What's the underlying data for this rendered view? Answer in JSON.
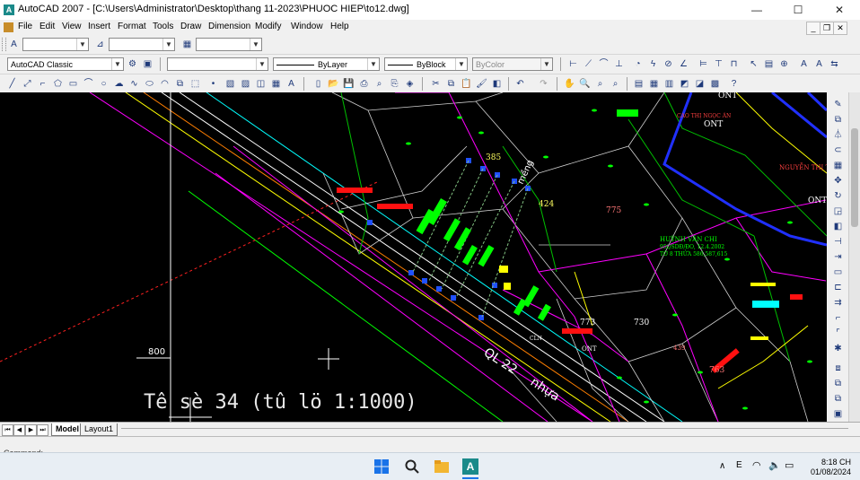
{
  "window": {
    "title": "AutoCAD 2007 - [C:\\Users\\Administrator\\Desktop\\thang 11-2023\\PHUOC HIEP\\to12.dwg]",
    "controls": {
      "minimize": "—",
      "maximize": "☐",
      "close": "✕"
    },
    "mdi_controls": {
      "minimize": "_",
      "restore": "❐",
      "close": "✕"
    }
  },
  "menu": [
    "File",
    "Edit",
    "View",
    "Insert",
    "Format",
    "Tools",
    "Draw",
    "Dimension",
    "Modify",
    "Window",
    "Help"
  ],
  "workspace": {
    "selected": "AutoCAD Classic"
  },
  "properties": {
    "linetype": "ByLayer",
    "lineweight": "ByBlock",
    "color": "ByColor"
  },
  "drawing": {
    "big_label": "Tê sè 34 (tû lö 1:1000)",
    "number_800": "800",
    "road_label": "QL 22",
    "road_label2": "nhựa",
    "parcels": [
      "385",
      "424",
      "775",
      "773",
      "730",
      "763",
      "439",
      "ONT",
      "ONT",
      "ONT",
      "ONT"
    ],
    "owner_1": "HUỲNH VĂN CHI",
    "owner_1_line2": "95QSDĐ/ĐO, 12.4.2002",
    "owner_1_line3": "TỜ 8 THỬA 586,587,615",
    "owner_2": "NGUYỄN THỊ T",
    "owner_3": "CAO THỊ NGỌC ÁN",
    "cln": "CLN"
  },
  "tabs": {
    "model": "Model",
    "layout1": "Layout1"
  },
  "command": {
    "prompt": "Command:"
  },
  "taskbar": {
    "time": "8:18 CH",
    "date": "01/08/2024"
  },
  "colors": {
    "canvas": "#000000",
    "lotline": "#ffffff",
    "magenta": "#ff00ff",
    "green": "#00ff00",
    "yellow": "#ffff00",
    "red": "#ff0000",
    "blue": "#0000ff",
    "cyan": "#00ffff"
  }
}
